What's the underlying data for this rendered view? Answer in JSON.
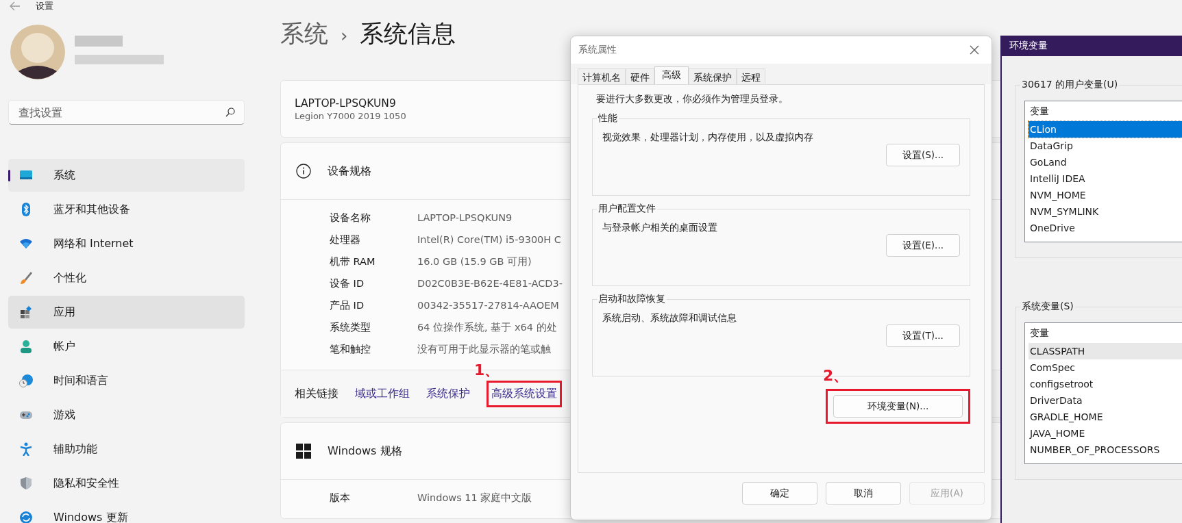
{
  "settings_window": {
    "title": "设置",
    "search": {
      "placeholder": "查找设置"
    },
    "nav_items": [
      {
        "label": "系统",
        "selected": true,
        "highlighted": false
      },
      {
        "label": "蓝牙和其他设备",
        "selected": false,
        "highlighted": false
      },
      {
        "label": "网络和 Internet",
        "selected": false,
        "highlighted": false
      },
      {
        "label": "个性化",
        "selected": false,
        "highlighted": false
      },
      {
        "label": "应用",
        "selected": false,
        "highlighted": true
      },
      {
        "label": "帐户",
        "selected": false,
        "highlighted": false
      },
      {
        "label": "时间和语言",
        "selected": false,
        "highlighted": false
      },
      {
        "label": "游戏",
        "selected": false,
        "highlighted": false
      },
      {
        "label": "辅助功能",
        "selected": false,
        "highlighted": false
      },
      {
        "label": "隐私和安全性",
        "selected": false,
        "highlighted": false
      },
      {
        "label": "Windows 更新",
        "selected": false,
        "highlighted": false
      }
    ],
    "breadcrumb": {
      "parent": "系统",
      "separator": "›",
      "current": "系统信息"
    },
    "device": {
      "name": "LAPTOP-LPSQKUN9",
      "model": "Legion Y7000 2019 1050"
    },
    "device_specs": {
      "title": "设备规格",
      "rows": [
        {
          "label": "设备名称",
          "value": "LAPTOP-LPSQKUN9"
        },
        {
          "label": "处理器",
          "value": "Intel(R) Core(TM) i5-9300H C"
        },
        {
          "label": "机带 RAM",
          "value": "16.0 GB (15.9 GB 可用)"
        },
        {
          "label": "设备 ID",
          "value": "D02C0B3E-B62E-4E81-ACD3-"
        },
        {
          "label": "产品 ID",
          "value": "00342-35517-27814-AAOEM"
        },
        {
          "label": "系统类型",
          "value": "64 位操作系统, 基于 x64 的处"
        },
        {
          "label": "笔和触控",
          "value": "没有可用于此显示器的笔或触"
        }
      ]
    },
    "related_links": {
      "label": "相关链接",
      "links": [
        {
          "label": "域或工作组"
        },
        {
          "label": "系统保护"
        },
        {
          "label": "高级系统设置",
          "callout": "1、"
        }
      ]
    },
    "windows_specs": {
      "title": "Windows 规格",
      "rows": [
        {
          "label": "版本",
          "value": "Windows 11 家庭中文版"
        }
      ]
    }
  },
  "system_properties": {
    "title": "系统属性",
    "tabs": [
      {
        "label": "计算机名",
        "selected": false
      },
      {
        "label": "硬件",
        "selected": false
      },
      {
        "label": "高级",
        "selected": true
      },
      {
        "label": "系统保护",
        "selected": false
      },
      {
        "label": "远程",
        "selected": false
      }
    ],
    "notice": "要进行大多数更改，你必须作为管理员登录。",
    "groups": [
      {
        "title": "性能",
        "description": "视觉效果，处理器计划，内存使用，以及虚拟内存",
        "button": "设置(S)..."
      },
      {
        "title": "用户配置文件",
        "description": "与登录帐户相关的桌面设置",
        "button": "设置(E)..."
      },
      {
        "title": "启动和故障恢复",
        "description": "系统启动、系统故障和调试信息",
        "button": "设置(T)..."
      }
    ],
    "env_button": {
      "label": "环境变量(N)...",
      "callout": "2、"
    },
    "footer_buttons": [
      {
        "label": "确定",
        "disabled": false
      },
      {
        "label": "取消",
        "disabled": false
      },
      {
        "label": "应用(A)",
        "disabled": true
      }
    ]
  },
  "environment_variables": {
    "title": "环境变量",
    "lists": [
      {
        "title": "30617 的用户变量(U)",
        "column": "变量",
        "rows": [
          {
            "name": "CLion",
            "selected": true,
            "highlighted": false
          },
          {
            "name": "DataGrip",
            "selected": false,
            "highlighted": false
          },
          {
            "name": "GoLand",
            "selected": false,
            "highlighted": false
          },
          {
            "name": "IntelliJ IDEA",
            "selected": false,
            "highlighted": false
          },
          {
            "name": "NVM_HOME",
            "selected": false,
            "highlighted": false
          },
          {
            "name": "NVM_SYMLINK",
            "selected": false,
            "highlighted": false
          },
          {
            "name": "OneDrive",
            "selected": false,
            "highlighted": false
          }
        ]
      },
      {
        "title": "系统变量(S)",
        "column": "变量",
        "rows": [
          {
            "name": "CLASSPATH",
            "selected": false,
            "highlighted": true
          },
          {
            "name": "ComSpec",
            "selected": false,
            "highlighted": false
          },
          {
            "name": "configsetroot",
            "selected": false,
            "highlighted": false
          },
          {
            "name": "DriverData",
            "selected": false,
            "highlighted": false
          },
          {
            "name": "GRADLE_HOME",
            "selected": false,
            "highlighted": false
          },
          {
            "name": "JAVA_HOME",
            "selected": false,
            "highlighted": false
          },
          {
            "name": "NUMBER_OF_PROCESSORS",
            "selected": false,
            "highlighted": false
          }
        ]
      }
    ]
  }
}
